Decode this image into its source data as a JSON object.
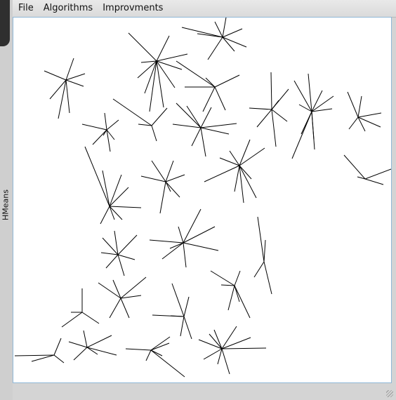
{
  "window": {
    "side_title": "HMeans"
  },
  "menubar": {
    "items": [
      "File",
      "Algorithms",
      "Improvments"
    ]
  },
  "canvas": {
    "stroke_color": "#000000",
    "background": "#ffffff",
    "cluster_count": 29
  }
}
